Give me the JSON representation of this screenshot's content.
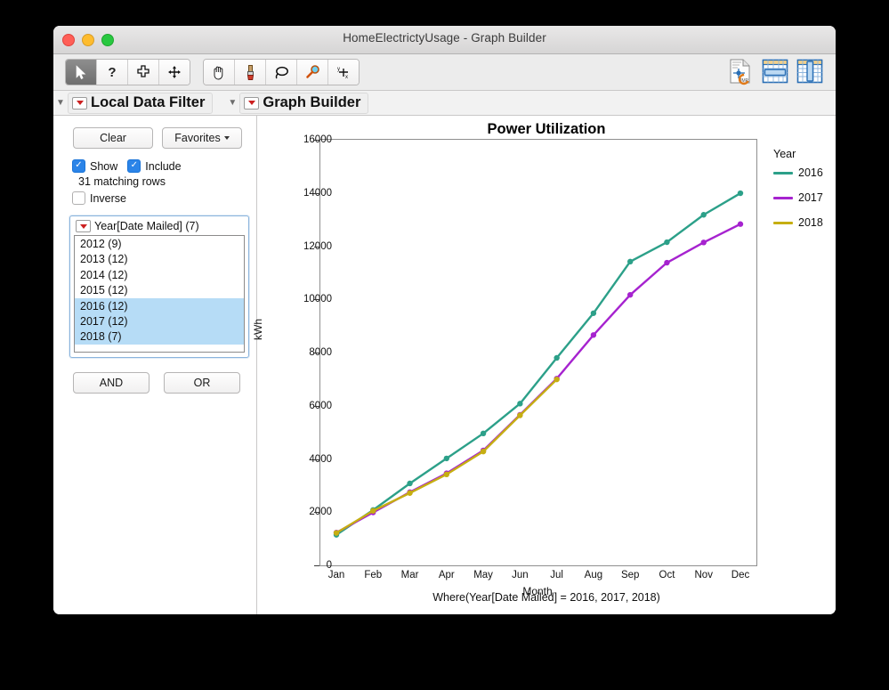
{
  "window": {
    "title": "HomeElectrictyUsage - Graph Builder",
    "traffic_lights": [
      "close",
      "minimize",
      "zoom"
    ]
  },
  "toolbar": {
    "left_group": [
      {
        "name": "arrow-select-tool",
        "glyph": "➤",
        "selected": true
      },
      {
        "name": "help-tool",
        "glyph": "?",
        "selected": false
      },
      {
        "name": "crosshair-tool",
        "glyph": "✣",
        "selected": false
      },
      {
        "name": "move-tool",
        "glyph": "✥",
        "selected": false
      }
    ],
    "right_group": [
      {
        "name": "hand-tool",
        "glyph": "✋",
        "selected": false
      },
      {
        "name": "brush-tool",
        "glyph": "🖌",
        "selected": false
      },
      {
        "name": "lasso-tool",
        "glyph": "◯",
        "selected": false
      },
      {
        "name": "magnifier-tool",
        "glyph": "🔍",
        "selected": false
      },
      {
        "name": "axis-crosshair-tool",
        "glyph": "✕",
        "selected": false
      }
    ],
    "far_right": [
      {
        "name": "jmp-data-table-icon"
      },
      {
        "name": "rows-table-icon"
      },
      {
        "name": "columns-table-icon"
      }
    ]
  },
  "panels": {
    "left_title": "Local Data Filter",
    "right_title": "Graph Builder"
  },
  "filter": {
    "clear_label": "Clear",
    "favorites_label": "Favorites",
    "show_label": "Show",
    "show_checked": true,
    "include_label": "Include",
    "include_checked": true,
    "matching_rows": "31 matching rows",
    "inverse_label": "Inverse",
    "inverse_checked": false,
    "group_label": "Year[Date Mailed] (7)",
    "items": [
      {
        "label": "2012 (9)",
        "selected": false
      },
      {
        "label": "2013 (12)",
        "selected": false
      },
      {
        "label": "2014 (12)",
        "selected": false
      },
      {
        "label": "2015 (12)",
        "selected": false
      },
      {
        "label": "2016 (12)",
        "selected": true
      },
      {
        "label": "2017 (12)",
        "selected": true
      },
      {
        "label": "2018 (7)",
        "selected": true
      }
    ],
    "and_label": "AND",
    "or_label": "OR"
  },
  "caption": "Where(Year[Date Mailed] = 2016, 2017, 2018)",
  "colors": {
    "series_2016": "#2CA089",
    "series_2017": "#A623CF",
    "series_2018": "#C6AE12",
    "selection_blue": "#b6dcf6",
    "checkbox_blue": "#2b84e8"
  },
  "chart_data": {
    "type": "line",
    "title": "Power Utilization",
    "xlabel": "Month",
    "ylabel": "kWh",
    "legend_title": "Year",
    "legend_position": "right",
    "grid": false,
    "ylim": [
      0,
      16000
    ],
    "yticks": [
      0,
      2000,
      4000,
      6000,
      8000,
      10000,
      12000,
      14000,
      16000
    ],
    "categories": [
      "Jan",
      "Feb",
      "Mar",
      "Apr",
      "May",
      "Jun",
      "Jul",
      "Aug",
      "Sep",
      "Oct",
      "Nov",
      "Dec"
    ],
    "series": [
      {
        "name": "2016",
        "color": "#2CA089",
        "values": [
          1150,
          2080,
          3080,
          4020,
          4960,
          6080,
          7800,
          9480,
          11420,
          12150,
          13180,
          13990
        ]
      },
      {
        "name": "2017",
        "color": "#A623CF",
        "values": [
          1230,
          1990,
          2750,
          3460,
          4320,
          5660,
          7020,
          8660,
          10170,
          11380,
          12140,
          12830
        ]
      },
      {
        "name": "2018",
        "color": "#C6AE12",
        "values": [
          1220,
          2050,
          2720,
          3420,
          4280,
          5640,
          6990,
          null,
          null,
          null,
          null,
          null
        ]
      }
    ]
  }
}
